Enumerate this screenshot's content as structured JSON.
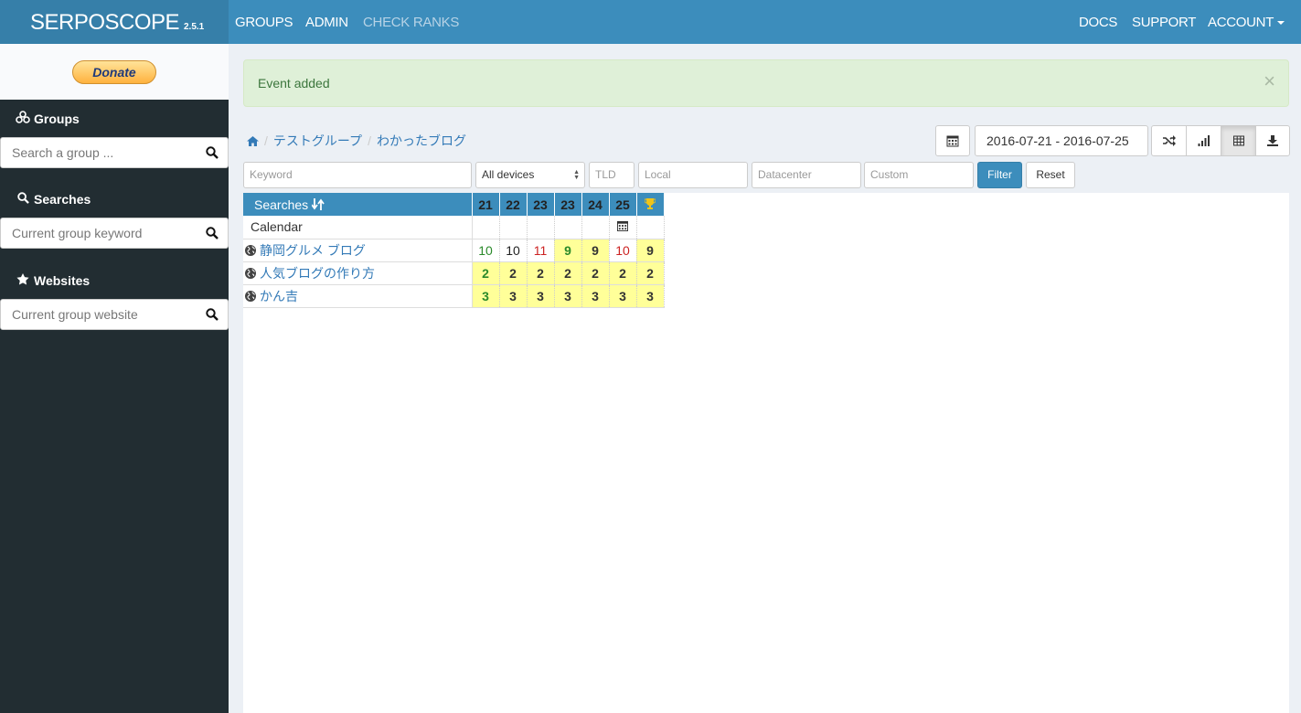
{
  "app": {
    "name": "SERPOSCOPE",
    "version": "2.5.1"
  },
  "nav": {
    "left": [
      "GROUPS",
      "ADMIN",
      "CHECK RANKS"
    ],
    "right": [
      "DOCS",
      "SUPPORT",
      "ACCOUNT"
    ]
  },
  "sidebar": {
    "donate_label": "Donate",
    "groups": {
      "title": "Groups",
      "placeholder": "Search a group ..."
    },
    "searches": {
      "title": "Searches",
      "placeholder": "Current group keyword"
    },
    "websites": {
      "title": "Websites",
      "placeholder": "Current group website"
    }
  },
  "alert": {
    "text": "Event added",
    "close": "×"
  },
  "breadcrumb": [
    "テストグループ",
    "わかったブログ"
  ],
  "date_range": "2016-07-21 - 2016-07-25",
  "filters": {
    "keyword_placeholder": "Keyword",
    "devices_value": "All devices",
    "tld_placeholder": "TLD",
    "local_placeholder": "Local",
    "datacenter_placeholder": "Datacenter",
    "custom_placeholder": "Custom",
    "filter_label": "Filter",
    "reset_label": "Reset"
  },
  "table": {
    "header_label": "Searches",
    "days": [
      "21",
      "22",
      "23",
      "23",
      "24",
      "25"
    ],
    "calendar_label": "Calendar",
    "rows": [
      {
        "keyword": "静岡グルメ ブログ",
        "ranks": [
          "10",
          "10",
          "11",
          "9",
          "9",
          "10"
        ],
        "best": "9"
      },
      {
        "keyword": "人気ブログの作り方",
        "ranks": [
          "2",
          "2",
          "2",
          "2",
          "2",
          "2"
        ],
        "best": "2"
      },
      {
        "keyword": "かん吉",
        "ranks": [
          "3",
          "3",
          "3",
          "3",
          "3",
          "3"
        ],
        "best": "3"
      }
    ]
  },
  "colors": {
    "navbar": "#3c8dbc",
    "brand": "#367fa9",
    "sidebar": "#222d32",
    "highlight": "#ffff99",
    "rank_up": "#2a8a2a",
    "rank_down": "#cc2222"
  }
}
